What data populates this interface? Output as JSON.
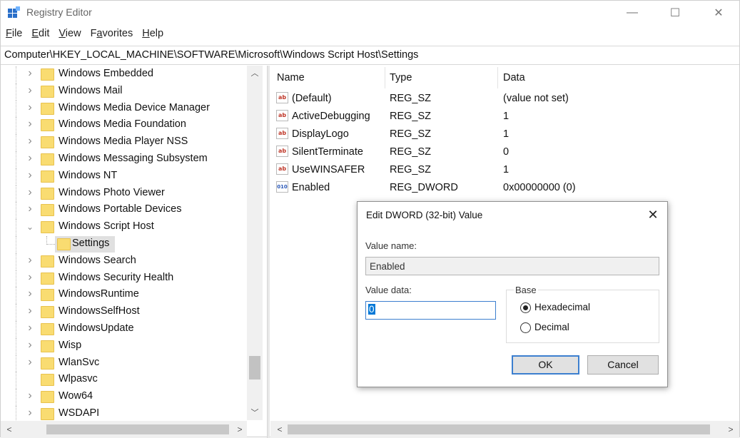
{
  "window": {
    "title": "Registry Editor"
  },
  "caption": {
    "minimize": "—",
    "maximize": "☐",
    "close": "✕"
  },
  "menu": [
    {
      "u": "F",
      "rest": "ile"
    },
    {
      "u": "E",
      "rest": "dit"
    },
    {
      "u": "V",
      "rest": "iew"
    },
    {
      "u": "",
      "pre": "F",
      "u2": "a",
      "rest": "vorites"
    },
    {
      "u": "H",
      "rest": "elp"
    }
  ],
  "address": "Computer\\HKEY_LOCAL_MACHINE\\SOFTWARE\\Microsoft\\Windows Script Host\\Settings",
  "tree": {
    "items": [
      {
        "label": "Windows Embedded",
        "chevron": ">"
      },
      {
        "label": "Windows Mail",
        "chevron": ">"
      },
      {
        "label": "Windows Media Device Manager",
        "chevron": ">"
      },
      {
        "label": "Windows Media Foundation",
        "chevron": ">"
      },
      {
        "label": "Windows Media Player NSS",
        "chevron": ">"
      },
      {
        "label": "Windows Messaging Subsystem",
        "chevron": ">"
      },
      {
        "label": "Windows NT",
        "chevron": ">"
      },
      {
        "label": "Windows Photo Viewer",
        "chevron": ">"
      },
      {
        "label": "Windows Portable Devices",
        "chevron": ">"
      },
      {
        "label": "Windows Script Host",
        "chevron": "v"
      },
      {
        "label": "Settings",
        "chevron": "",
        "sub": true,
        "selected": true
      },
      {
        "label": "Windows Search",
        "chevron": ">"
      },
      {
        "label": "Windows Security Health",
        "chevron": ">"
      },
      {
        "label": "WindowsRuntime",
        "chevron": ">"
      },
      {
        "label": "WindowsSelfHost",
        "chevron": ">"
      },
      {
        "label": "WindowsUpdate",
        "chevron": ">"
      },
      {
        "label": "Wisp",
        "chevron": ">"
      },
      {
        "label": "WlanSvc",
        "chevron": ">"
      },
      {
        "label": "Wlpasvc",
        "chevron": ""
      },
      {
        "label": "Wow64",
        "chevron": ">"
      },
      {
        "label": "WSDAPI",
        "chevron": ">"
      }
    ]
  },
  "list": {
    "headers": {
      "name": "Name",
      "type": "Type",
      "data": "Data"
    },
    "rows": [
      {
        "icon": "ab",
        "name": "(Default)",
        "type": "REG_SZ",
        "data": "(value not set)"
      },
      {
        "icon": "ab",
        "name": "ActiveDebugging",
        "type": "REG_SZ",
        "data": "1"
      },
      {
        "icon": "ab",
        "name": "DisplayLogo",
        "type": "REG_SZ",
        "data": "1"
      },
      {
        "icon": "ab",
        "name": "SilentTerminate",
        "type": "REG_SZ",
        "data": "0"
      },
      {
        "icon": "ab",
        "name": "UseWINSAFER",
        "type": "REG_SZ",
        "data": "1"
      },
      {
        "icon": "010",
        "name": "Enabled",
        "type": "REG_DWORD",
        "data": "0x00000000 (0)"
      }
    ]
  },
  "dialog": {
    "title": "Edit DWORD (32-bit) Value",
    "value_name_label": "Value name:",
    "value_name": "Enabled",
    "value_data_label": "Value data:",
    "value_data": "0",
    "base_label": "Base",
    "hex_label": "Hexadecimal",
    "dec_label": "Decimal",
    "ok_label": "OK",
    "cancel_label": "Cancel"
  }
}
